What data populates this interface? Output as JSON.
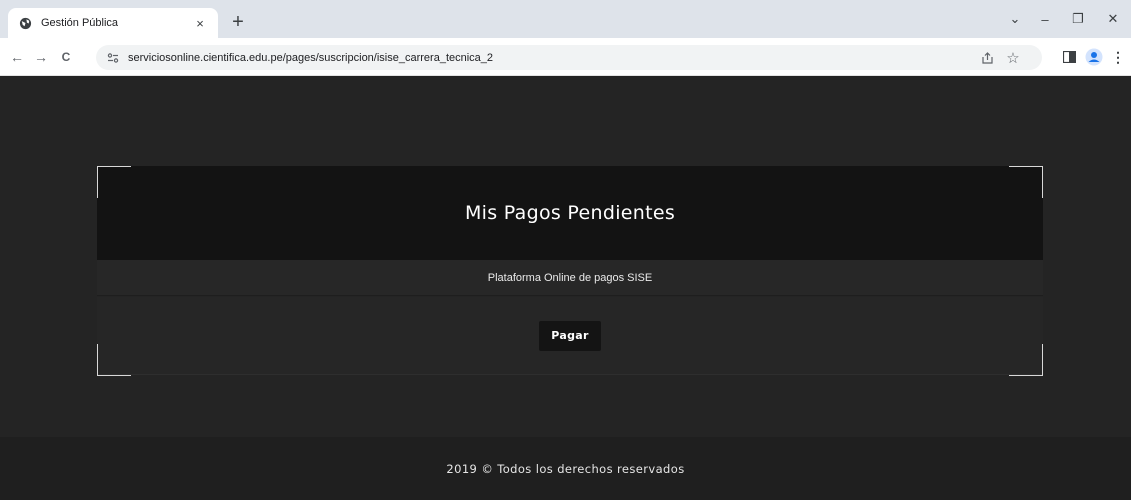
{
  "browser": {
    "tab": {
      "title": "Gestión Pública",
      "close_glyph": "×",
      "favicon": "globe-icon"
    },
    "new_tab_glyph": "+",
    "window_controls": {
      "tab_search": "⌄",
      "minimize": "–",
      "maximize": "❐",
      "close": "✕"
    },
    "nav": {
      "back": "←",
      "forward": "→",
      "reload": "C"
    },
    "url": "serviciosonline.cientifica.edu.pe/pages/suscripcion/isise_carrera_tecnica_2",
    "icons": [
      "share-icon",
      "star-icon",
      "side-panel-icon",
      "profile-icon",
      "menu-icon"
    ]
  },
  "card": {
    "title": "Mis Pagos Pendientes",
    "subtitle": "Plataforma Online de pagos SISE",
    "pay_button": "Pagar"
  },
  "footer": {
    "text": "2019 © Todos los derechos reservados"
  },
  "colors": {
    "page_bg": "#242424",
    "header_bg": "#131313",
    "footer_bg": "#1f1f1f",
    "profile_blue": "#1a73e8"
  }
}
